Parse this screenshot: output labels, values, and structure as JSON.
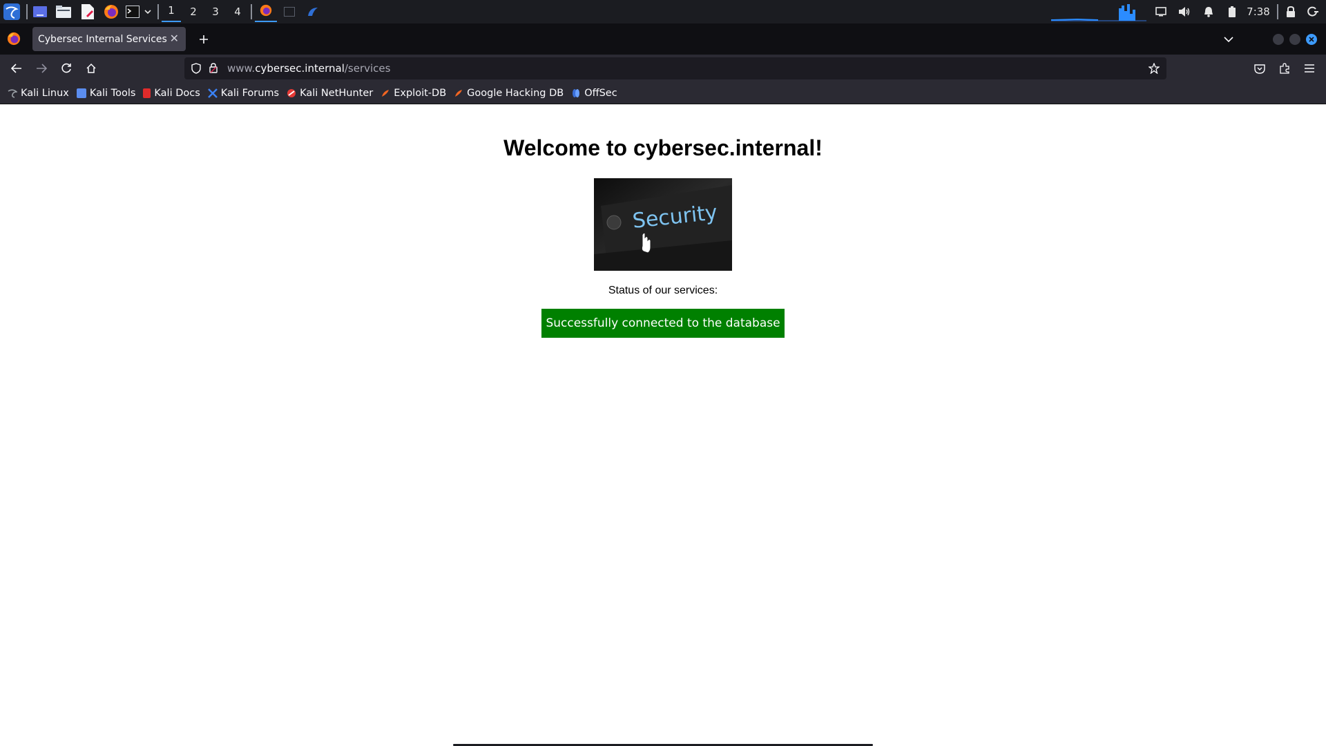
{
  "panel": {
    "workspaces": [
      "1",
      "2",
      "3",
      "4"
    ],
    "active_workspace": "1",
    "clock": "7:38",
    "accent_color": "#3d9bff"
  },
  "browser": {
    "tab_title": "Cybersec Internal Services",
    "url_prefix": "www.",
    "url_host": "cybersec.internal",
    "url_path": "/services"
  },
  "bookmarks": [
    {
      "label": "Kali Linux",
      "icon": "kali-dragon-icon",
      "color": "#9aa0a6"
    },
    {
      "label": "Kali Tools",
      "icon": "kali-tools-icon",
      "color": "#5b8def"
    },
    {
      "label": "Kali Docs",
      "icon": "kali-docs-icon",
      "color": "#e02b2b"
    },
    {
      "label": "Kali Forums",
      "icon": "kali-forums-icon",
      "color": "#3b82f6"
    },
    {
      "label": "Kali NetHunter",
      "icon": "nethunter-icon",
      "color": "#e53935"
    },
    {
      "label": "Exploit-DB",
      "icon": "exploit-db-icon",
      "color": "#f26522"
    },
    {
      "label": "Google Hacking DB",
      "icon": "ghdb-icon",
      "color": "#f26522"
    },
    {
      "label": "OffSec",
      "icon": "offsec-icon",
      "color": "#3b6fd8"
    }
  ],
  "page": {
    "title": "Welcome to cybersec.internal!",
    "image_text": "Security",
    "status_label": "Status of our services:",
    "status_message": "Successfully connected to the database",
    "status_color": "#008000"
  }
}
